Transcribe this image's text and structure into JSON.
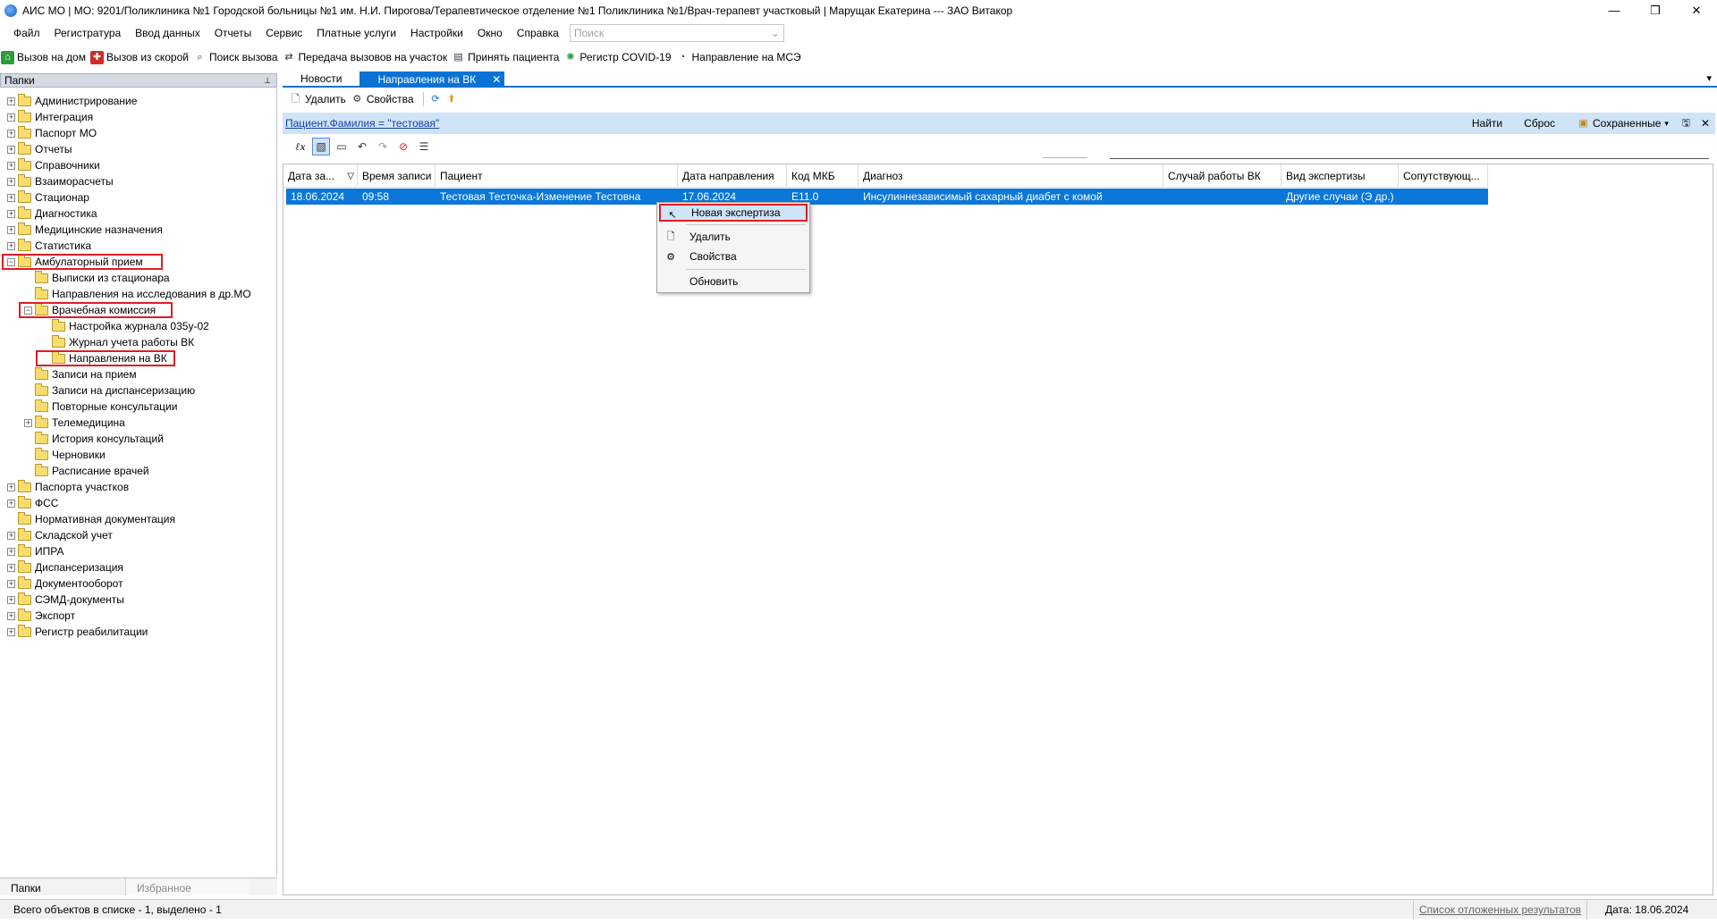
{
  "window": {
    "title": "АИС МО | МО: 9201/Поликлиника №1 Городской больницы №1 им. Н.И. Пирогова/Терапевтическое отделение №1 Поликлиника №1/Врач-терапевт участковый | Марущак Екатерина --- ЗАО Витакор",
    "minimize": "—",
    "maximize": "❐",
    "close": "✕"
  },
  "menu": {
    "items": [
      "Файл",
      "Регистратура",
      "Ввод данных",
      "Отчеты",
      "Сервис",
      "Платные услуги",
      "Настройки",
      "Окно",
      "Справка"
    ],
    "search_placeholder": "Поиск"
  },
  "toolbar": {
    "items": [
      {
        "label": "Вызов на дом",
        "icon": "house-call-icon"
      },
      {
        "label": "Вызов из скорой",
        "icon": "ambulance-call-icon"
      },
      {
        "label": "Поиск вызова",
        "icon": "find-call-icon"
      },
      {
        "label": "Передача вызовов на участок",
        "icon": "transfer-icon"
      },
      {
        "label": "Принять пациента",
        "icon": "accept-patient-icon"
      },
      {
        "label": "Регистр COVID-19",
        "icon": "covid-icon"
      },
      {
        "label": "Направление на МСЭ",
        "icon": "mse-icon"
      }
    ]
  },
  "left_panel": {
    "title": "Папки",
    "pin": "📌",
    "tree": [
      {
        "label": "Администрирование",
        "level": 0,
        "expand": "+"
      },
      {
        "label": "Интеграция",
        "level": 0,
        "expand": "+"
      },
      {
        "label": "Паспорт МО",
        "level": 0,
        "expand": "+"
      },
      {
        "label": "Отчеты",
        "level": 0,
        "expand": "+"
      },
      {
        "label": "Справочники",
        "level": 0,
        "expand": "+"
      },
      {
        "label": "Взаиморасчеты",
        "level": 0,
        "expand": "+"
      },
      {
        "label": "Стационар",
        "level": 0,
        "expand": "+"
      },
      {
        "label": "Диагностика",
        "level": 0,
        "expand": "+"
      },
      {
        "label": "Медицинские назначения",
        "level": 0,
        "expand": "+"
      },
      {
        "label": "Статистика",
        "level": 0,
        "expand": "+"
      },
      {
        "label": "Амбулаторный прием",
        "level": 0,
        "expand": "−",
        "highlight": true
      },
      {
        "label": "Выписки из стационара",
        "level": 1,
        "expand": ""
      },
      {
        "label": "Направления на исследования в др.МО",
        "level": 1,
        "expand": ""
      },
      {
        "label": "Врачебная комиссия",
        "level": 1,
        "expand": "−",
        "highlight": true
      },
      {
        "label": "Настройка журнала 035у-02",
        "level": 2,
        "expand": ""
      },
      {
        "label": "Журнал учета работы ВК",
        "level": 2,
        "expand": ""
      },
      {
        "label": "Направления на ВК",
        "level": 2,
        "expand": "",
        "highlight": true,
        "open": true
      },
      {
        "label": "Записи на прием",
        "level": 1,
        "expand": ""
      },
      {
        "label": "Записи на диспансеризацию",
        "level": 1,
        "expand": ""
      },
      {
        "label": "Повторные консультации",
        "level": 1,
        "expand": ""
      },
      {
        "label": "Телемедицина",
        "level": 1,
        "expand": "+"
      },
      {
        "label": "История консультаций",
        "level": 1,
        "expand": ""
      },
      {
        "label": "Черновики",
        "level": 1,
        "expand": ""
      },
      {
        "label": "Расписание врачей",
        "level": 1,
        "expand": ""
      },
      {
        "label": "Паспорта участков",
        "level": 0,
        "expand": "+"
      },
      {
        "label": "ФСС",
        "level": 0,
        "expand": "+"
      },
      {
        "label": "Нормативная документация",
        "level": 0,
        "expand": ""
      },
      {
        "label": "Складской учет",
        "level": 0,
        "expand": "+"
      },
      {
        "label": "ИПРА",
        "level": 0,
        "expand": "+"
      },
      {
        "label": "Диспансеризация",
        "level": 0,
        "expand": "+"
      },
      {
        "label": "Документооборот",
        "level": 0,
        "expand": "+"
      },
      {
        "label": "СЭМД-документы",
        "level": 0,
        "expand": "+"
      },
      {
        "label": "Экспорт",
        "level": 0,
        "expand": "+"
      },
      {
        "label": "Регистр реабилитации",
        "level": 0,
        "expand": "+"
      }
    ],
    "tabs": [
      "Папки",
      "Избранное"
    ]
  },
  "tabs": [
    {
      "label": "Новости",
      "active": false
    },
    {
      "label": "Направления на ВК",
      "active": true
    }
  ],
  "tab_close": "✕",
  "tab_dropdown": "▾",
  "doc_toolbar": {
    "delete": "Удалить",
    "properties": "Свойства"
  },
  "filter": {
    "expression": "Пациент.Фамилия = \"тестовая\"",
    "find": "Найти",
    "reset": "Сброс",
    "saved": "Сохраненные",
    "close": "✕"
  },
  "grid": {
    "columns": [
      "Дата за...",
      "Время записи",
      "Пациент",
      "Дата направления",
      "Код МКБ",
      "Диагноз",
      "Случай работы ВК",
      "Вид экспертизы",
      "Сопутствующ..."
    ],
    "rows": [
      [
        "18.06.2024",
        "09:58",
        "Тестовая Тесточка-Изменение Тестовна",
        "17.06.2024",
        "E11.0",
        "Инсулиннезависимый сахарный диабет с комой",
        "",
        "Другие случаи (Э др.)",
        ""
      ]
    ]
  },
  "context_menu": {
    "items": [
      "Новая экспертиза",
      "Удалить",
      "Свойства",
      "Обновить"
    ]
  },
  "status": {
    "text": "Всего объектов в списке - 1, выделено - 1",
    "deferred_link": "Список отложенных результатов",
    "date": "Дата: 18.06.2024"
  }
}
